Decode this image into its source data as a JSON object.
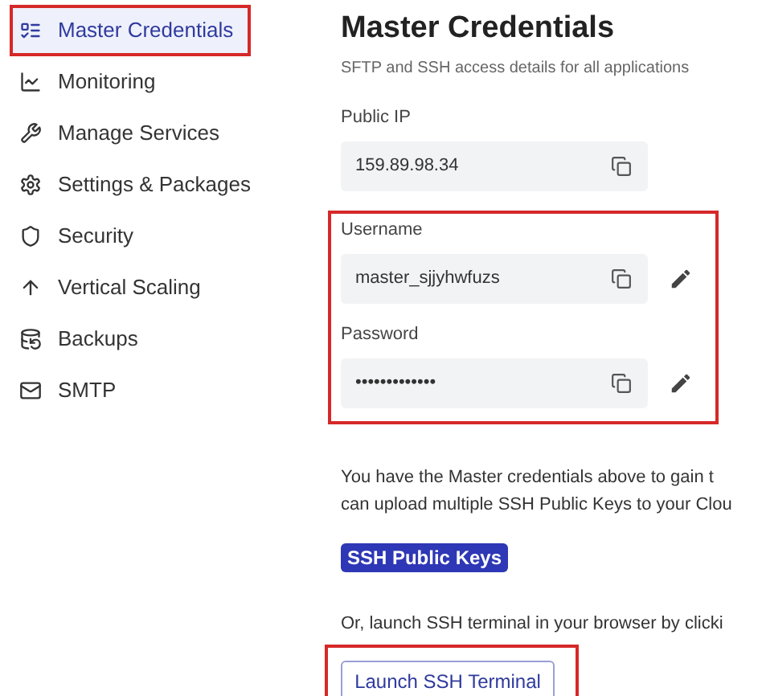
{
  "sidebar": {
    "items": [
      {
        "label": "Master Credentials",
        "selected": true,
        "highlighted": true
      },
      {
        "label": "Monitoring",
        "selected": false,
        "highlighted": false
      },
      {
        "label": "Manage Services",
        "selected": false,
        "highlighted": false
      },
      {
        "label": "Settings & Packages",
        "selected": false,
        "highlighted": false
      },
      {
        "label": "Security",
        "selected": false,
        "highlighted": false
      },
      {
        "label": "Vertical Scaling",
        "selected": false,
        "highlighted": false
      },
      {
        "label": "Backups",
        "selected": false,
        "highlighted": false
      },
      {
        "label": "SMTP",
        "selected": false,
        "highlighted": false
      }
    ]
  },
  "main": {
    "title": "Master Credentials",
    "subtitle": "SFTP and SSH access details for all applications",
    "public_ip": {
      "label": "Public IP",
      "value": "159.89.98.34"
    },
    "highlighted_fields": [
      {
        "label": "Username",
        "value": "master_sjjyhwfuzs",
        "editable": true
      },
      {
        "label": "Password",
        "value": "•••••••••••••",
        "editable": true
      }
    ],
    "paragraph": [
      "You have the Master credentials above to gain t",
      "can upload multiple SSH Public Keys to your Clou"
    ],
    "primary_button": "SSH Public Keys",
    "terminal_text": "Or, launch SSH terminal in your browser by clicki",
    "terminal_button": {
      "label": "Launch SSH Terminal",
      "highlighted": true
    }
  }
}
